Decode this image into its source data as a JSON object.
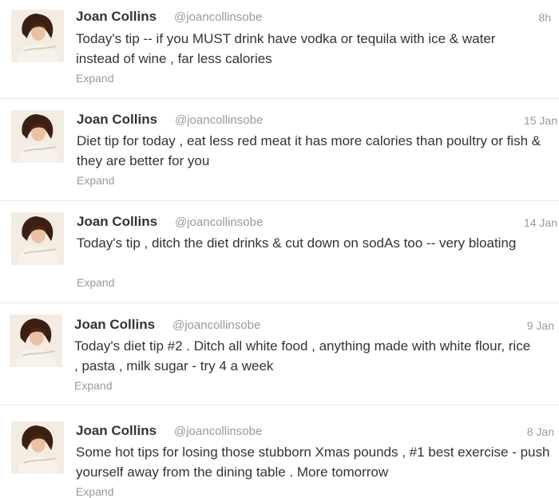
{
  "tweets": [
    {
      "author_name": "Joan Collins",
      "handle": "@joancollinsobe",
      "time": "8h",
      "text": "Today's tip -- if you MUST drink have vodka or tequila with ice & water instead of wine , far less calories",
      "expand_label": "Expand",
      "avatar_icon": "profile-photo"
    },
    {
      "author_name": "Joan Collins",
      "handle": "@joancollinsobe",
      "time": "15 Jan",
      "text": "Diet tip for today , eat less red meat it has more calories than poultry or fish & they are better for you",
      "expand_label": "Expand",
      "avatar_icon": "profile-photo"
    },
    {
      "author_name": "Joan Collins",
      "handle": "@joancollinsobe",
      "time": "14 Jan",
      "text": "Today's tip , ditch the diet drinks & cut down on sodAs too -- very bloating",
      "expand_label": "Expand",
      "avatar_icon": "profile-photo"
    },
    {
      "author_name": "Joan Collins",
      "handle": "@joancollinsobe",
      "time": "9 Jan",
      "text": "Today's diet tip #2 . Ditch all white food , anything made with white flour, rice , pasta , milk sugar - try 4 a week",
      "expand_label": "Expand",
      "avatar_icon": "profile-photo"
    },
    {
      "author_name": "Joan Collins",
      "handle": "@joancollinsobe",
      "time": "8 Jan",
      "text": "Some hot tips for losing those stubborn Xmas pounds , #1 best exercise - push yourself away from the dining table . More tomorrow",
      "expand_label": "Expand",
      "avatar_icon": "profile-photo"
    }
  ]
}
